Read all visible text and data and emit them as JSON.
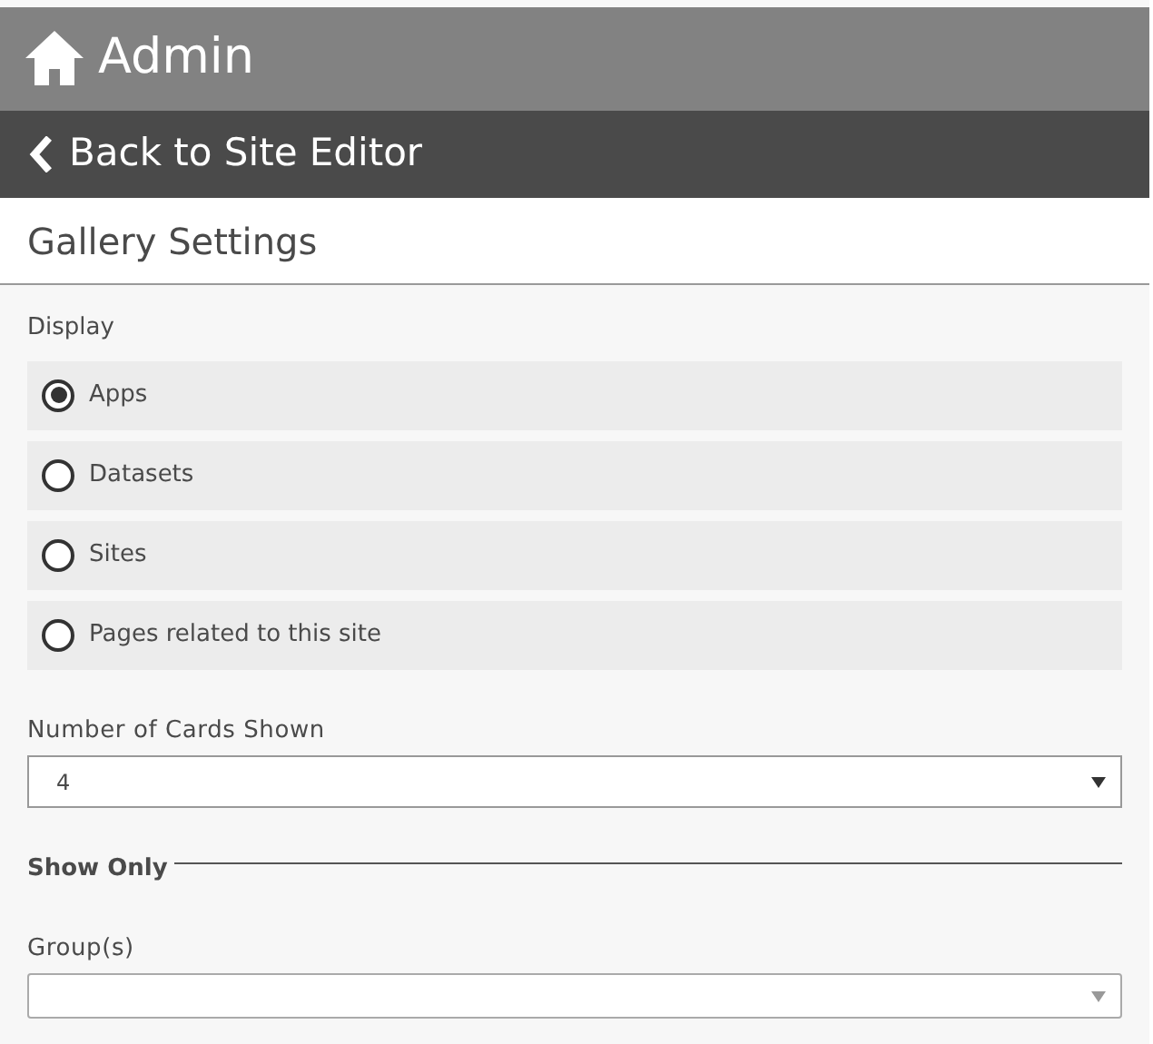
{
  "header": {
    "title": "Admin"
  },
  "back_link": {
    "label": "Back to Site Editor"
  },
  "panel": {
    "title": "Gallery Settings"
  },
  "display": {
    "label": "Display",
    "options": [
      {
        "label": "Apps",
        "selected": true
      },
      {
        "label": "Datasets",
        "selected": false
      },
      {
        "label": "Sites",
        "selected": false
      },
      {
        "label": "Pages related to this site",
        "selected": false
      }
    ]
  },
  "cards_shown": {
    "label": "Number of Cards Shown",
    "value": "4"
  },
  "show_only": {
    "heading": "Show Only",
    "groups": {
      "label": "Group(s)"
    }
  }
}
